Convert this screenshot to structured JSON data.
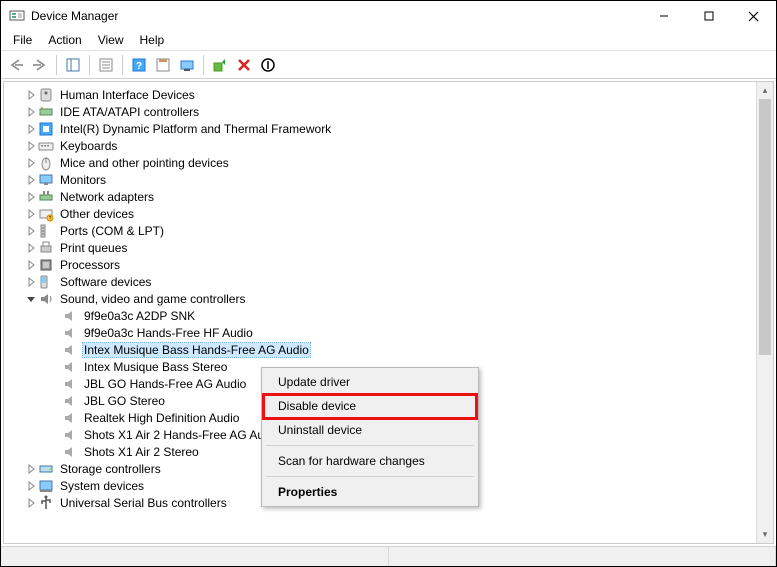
{
  "window": {
    "title": "Device Manager"
  },
  "menu": {
    "file": "File",
    "action": "Action",
    "view": "View",
    "help": "Help"
  },
  "tree": {
    "categories": [
      {
        "label": "Human Interface Devices",
        "icon": "hid"
      },
      {
        "label": "IDE ATA/ATAPI controllers",
        "icon": "ide"
      },
      {
        "label": "Intel(R) Dynamic Platform and Thermal Framework",
        "icon": "intel"
      },
      {
        "label": "Keyboards",
        "icon": "keyboard"
      },
      {
        "label": "Mice and other pointing devices",
        "icon": "mouse"
      },
      {
        "label": "Monitors",
        "icon": "monitor"
      },
      {
        "label": "Network adapters",
        "icon": "network"
      },
      {
        "label": "Other devices",
        "icon": "other"
      },
      {
        "label": "Ports (COM & LPT)",
        "icon": "port"
      },
      {
        "label": "Print queues",
        "icon": "printer"
      },
      {
        "label": "Processors",
        "icon": "cpu"
      },
      {
        "label": "Software devices",
        "icon": "software"
      },
      {
        "label": "Sound, video and game controllers",
        "icon": "sound",
        "expanded": true
      },
      {
        "label": "Storage controllers",
        "icon": "storage"
      },
      {
        "label": "System devices",
        "icon": "system"
      },
      {
        "label": "Universal Serial Bus controllers",
        "icon": "usb"
      }
    ],
    "sound_children": [
      {
        "label": "9f9e0a3c A2DP SNK"
      },
      {
        "label": "9f9e0a3c Hands-Free HF Audio"
      },
      {
        "label": "Intex Musique Bass Hands-Free AG Audio",
        "selected": true
      },
      {
        "label": "Intex Musique Bass Stereo"
      },
      {
        "label": "JBL GO Hands-Free AG Audio"
      },
      {
        "label": "JBL GO Stereo"
      },
      {
        "label": "Realtek High Definition Audio"
      },
      {
        "label": "Shots X1 Air 2 Hands-Free AG Audio"
      },
      {
        "label": "Shots X1 Air 2 Stereo"
      }
    ]
  },
  "context_menu": {
    "update": "Update driver",
    "disable": "Disable device",
    "uninstall": "Uninstall device",
    "scan": "Scan for hardware changes",
    "properties": "Properties"
  }
}
